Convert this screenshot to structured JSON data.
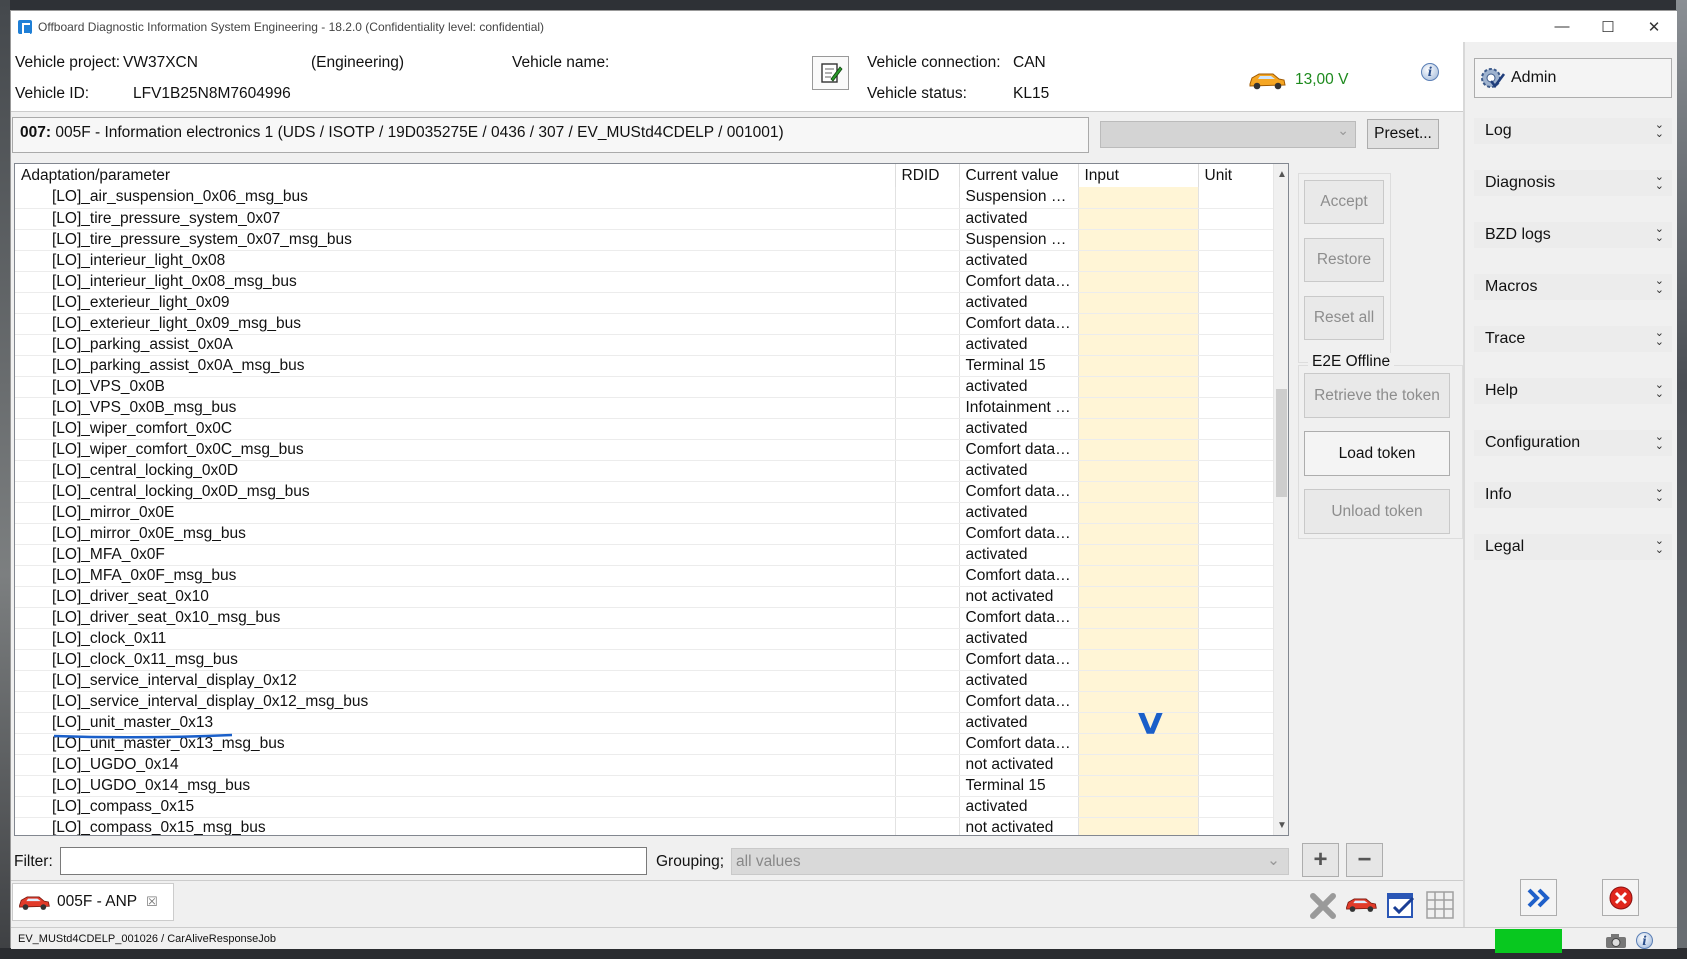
{
  "window": {
    "title": "Offboard Diagnostic Information System Engineering - 18.2.0 (Confidentiality level: confidential)",
    "minimize": "—",
    "maximize": "☐",
    "close": "✕"
  },
  "header": {
    "vehicle_project_label": "Vehicle project:",
    "vehicle_project_value": "VW37XCN",
    "mode": "(Engineering)",
    "vehicle_name_label": "Vehicle name:",
    "vehicle_id_label": "Vehicle ID:",
    "vehicle_id_value": "LFV1B25N8M7604996",
    "connection_label": "Vehicle connection:",
    "connection_value": "CAN",
    "status_label": "Vehicle status:",
    "status_value": "KL15",
    "voltage": "13,00 V"
  },
  "ecu": {
    "address": "007:",
    "description": "005F - Information electronics 1  (UDS / ISOTP / 19D035275E / 0436 / 307 / EV_MUStd4CDELP / 001001)",
    "preset_label": "Preset..."
  },
  "table": {
    "columns": [
      "Adaptation/parameter",
      "RDID",
      "Current value",
      "Input",
      "Unit"
    ],
    "rows": [
      {
        "param": "[LO]_air_suspension_0x06_msg_bus",
        "value": "Suspension d..."
      },
      {
        "param": "[LO]_tire_pressure_system_0x07",
        "value": "activated"
      },
      {
        "param": "[LO]_tire_pressure_system_0x07_msg_bus",
        "value": "Suspension d..."
      },
      {
        "param": "[LO]_interieur_light_0x08",
        "value": "activated"
      },
      {
        "param": "[LO]_interieur_light_0x08_msg_bus",
        "value": "Comfort data ..."
      },
      {
        "param": "[LO]_exterieur_light_0x09",
        "value": "activated"
      },
      {
        "param": "[LO]_exterieur_light_0x09_msg_bus",
        "value": "Comfort data ..."
      },
      {
        "param": "[LO]_parking_assist_0x0A",
        "value": "activated"
      },
      {
        "param": "[LO]_parking_assist_0x0A_msg_bus",
        "value": "Terminal 15"
      },
      {
        "param": "[LO]_VPS_0x0B",
        "value": "activated"
      },
      {
        "param": "[LO]_VPS_0x0B_msg_bus",
        "value": "Infotainment d..."
      },
      {
        "param": "[LO]_wiper_comfort_0x0C",
        "value": "activated"
      },
      {
        "param": "[LO]_wiper_comfort_0x0C_msg_bus",
        "value": "Comfort data ..."
      },
      {
        "param": "[LO]_central_locking_0x0D",
        "value": "activated"
      },
      {
        "param": "[LO]_central_locking_0x0D_msg_bus",
        "value": "Comfort data ..."
      },
      {
        "param": "[LO]_mirror_0x0E",
        "value": "activated"
      },
      {
        "param": "[LO]_mirror_0x0E_msg_bus",
        "value": "Comfort data ..."
      },
      {
        "param": "[LO]_MFA_0x0F",
        "value": "activated"
      },
      {
        "param": "[LO]_MFA_0x0F_msg_bus",
        "value": "Comfort data ..."
      },
      {
        "param": "[LO]_driver_seat_0x10",
        "value": "not activated"
      },
      {
        "param": "[LO]_driver_seat_0x10_msg_bus",
        "value": "Comfort data ..."
      },
      {
        "param": "[LO]_clock_0x11",
        "value": "activated"
      },
      {
        "param": "[LO]_clock_0x11_msg_bus",
        "value": "Comfort data ..."
      },
      {
        "param": "[LO]_service_interval_display_0x12",
        "value": "activated"
      },
      {
        "param": "[LO]_service_interval_display_0x12_msg_bus",
        "value": "Comfort data ..."
      },
      {
        "param": "[LO]_unit_master_0x13",
        "value": "activated"
      },
      {
        "param": "[LO]_unit_master_0x13_msg_bus",
        "value": "Comfort data ..."
      },
      {
        "param": "[LO]_UGDO_0x14",
        "value": "not activated"
      },
      {
        "param": "[LO]_UGDO_0x14_msg_bus",
        "value": "Terminal 15"
      },
      {
        "param": "[LO]_compass_0x15",
        "value": "activated"
      },
      {
        "param": "[LO]_compass_0x15_msg_bus",
        "value": "not activated"
      }
    ]
  },
  "actions": {
    "accept": "Accept",
    "restore": "Restore",
    "reset_all": "Reset all",
    "e2e_label": "E2E Offline",
    "retrieve_token": "Retrieve the token",
    "load_token": "Load token",
    "unload_token": "Unload token"
  },
  "filter": {
    "label": "Filter:",
    "value": "",
    "grouping_label": "Grouping;",
    "grouping_value": "all values"
  },
  "tab": {
    "label": "005F - ANP",
    "close": "☒"
  },
  "status": {
    "text": "EV_MUStd4CDELP_001026 / CarAliveResponseJob",
    "indicator_color": "#08c81f"
  },
  "sidebar": {
    "admin_label": "Admin",
    "items": [
      "Log",
      "Diagnosis",
      "BZD logs",
      "Macros",
      "Trace",
      "Help",
      "Configuration",
      "Info",
      "Legal"
    ]
  },
  "annotation": {
    "mark": "V",
    "color": "#1a5fc9"
  }
}
